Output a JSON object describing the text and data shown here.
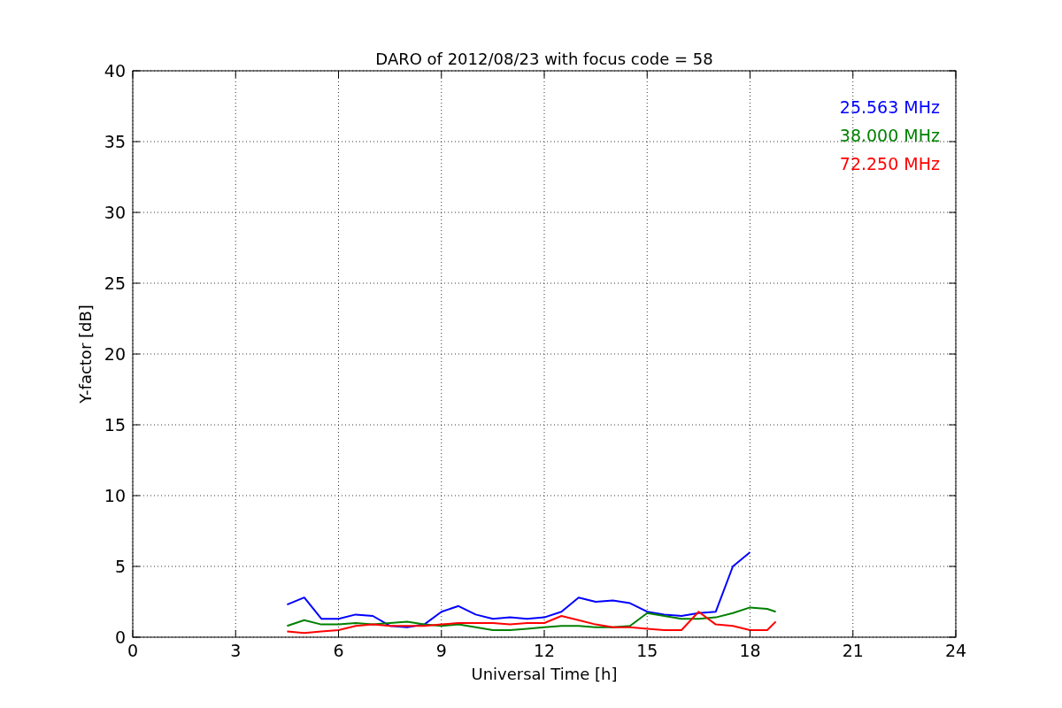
{
  "figure": {
    "chart_data": {
      "type": "line",
      "title": "DARO of 2012/08/23 with focus code = 58",
      "xlabel": "Universal Time [h]",
      "ylabel": "Y-factor [dB]",
      "x": [
        4.5,
        5,
        5.5,
        6,
        6.5,
        7,
        7.5,
        8,
        8.5,
        9,
        9.5,
        10,
        10.5,
        11,
        11.5,
        12,
        12.5,
        13,
        13.5,
        14,
        14.5,
        15,
        15.5,
        16,
        16.5,
        17,
        17.5,
        18,
        18.5,
        18.75
      ],
      "series": [
        {
          "name": "25.563 MHz",
          "color": "#0000ff",
          "values": [
            2.3,
            2.8,
            1.3,
            1.3,
            1.6,
            1.5,
            0.8,
            0.7,
            0.9,
            1.8,
            2.2,
            1.6,
            1.3,
            1.4,
            1.3,
            1.4,
            1.8,
            2.8,
            2.5,
            2.6,
            2.4,
            1.8,
            1.6,
            1.5,
            1.7,
            1.8,
            5,
            6,
            null,
            null
          ]
        },
        {
          "name": "38.000 MHz",
          "color": "#008000",
          "values": [
            0.8,
            1.2,
            0.9,
            0.9,
            1.0,
            0.9,
            1.0,
            1.1,
            0.9,
            0.8,
            0.9,
            0.7,
            0.5,
            0.5,
            0.6,
            0.7,
            0.8,
            0.8,
            0.7,
            0.7,
            0.8,
            1.7,
            1.5,
            1.3,
            1.3,
            1.4,
            1.7,
            2.1,
            2.0,
            1.8
          ]
        },
        {
          "name": "72.250 MHz",
          "color": "#ff0000",
          "values": [
            0.4,
            0.3,
            0.4,
            0.5,
            0.8,
            0.9,
            0.8,
            0.8,
            0.8,
            0.9,
            1.0,
            1.0,
            1.0,
            0.9,
            1.0,
            1.0,
            1.5,
            1.2,
            0.9,
            0.7,
            0.7,
            0.6,
            0.5,
            0.5,
            1.8,
            0.9,
            0.8,
            0.5,
            0.5,
            1.1
          ]
        }
      ],
      "xlim": [
        0,
        24
      ],
      "ylim": [
        0,
        40
      ],
      "xticks": [
        0,
        3,
        6,
        9,
        12,
        15,
        18,
        21,
        24
      ],
      "yticks": [
        0,
        5,
        10,
        15,
        20,
        25,
        30,
        35,
        40
      ],
      "grid": true
    }
  }
}
